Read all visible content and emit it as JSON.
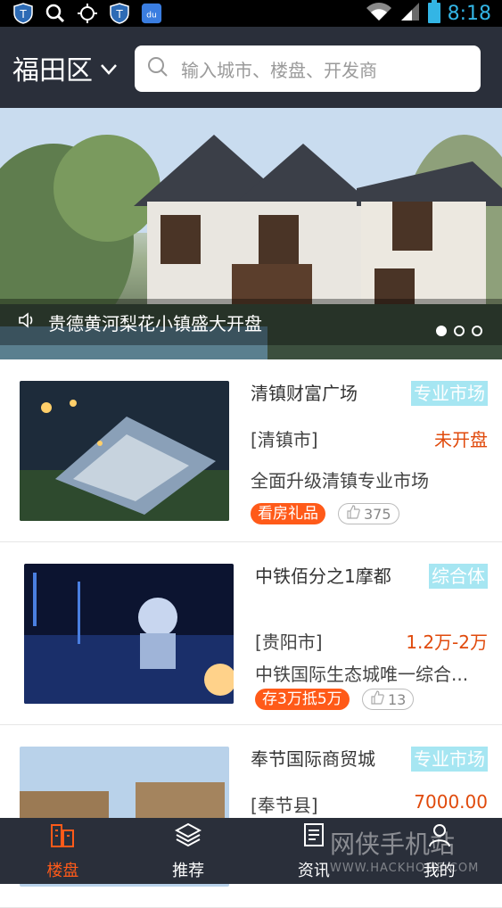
{
  "status_bar": {
    "time": "8:18",
    "icons": [
      "shield-app-icon",
      "search-icon",
      "locate-icon",
      "shield-app-icon",
      "baidu-app-icon",
      "wifi-icon",
      "signal-icon",
      "battery-icon"
    ],
    "baidu_label": "du"
  },
  "header": {
    "location": "福田区",
    "search_placeholder": "输入城市、楼盘、开发商"
  },
  "banner": {
    "title": "贵德黄河梨花小镇盛大开盘",
    "slides": 3,
    "active_slide": 0
  },
  "listings": [
    {
      "name": "清镇财富广场",
      "tag": "专业市场",
      "city": "[清镇市]",
      "price": "未开盘",
      "desc": "全面升级清镇专业市场",
      "badge": "看房礼品",
      "likes": "375"
    },
    {
      "name": "中铁佰分之1摩都",
      "tag": "综合体",
      "city": "[贵阳市]",
      "price": "1.2万-2万",
      "desc": "中铁国际生态城唯一综合...",
      "badge": "存3万抵5万",
      "likes": "13"
    },
    {
      "name": "奉节国际商贸城",
      "tag": "专业市场",
      "city": "[奉节县]",
      "price": "7000.00"
    }
  ],
  "tabs": [
    {
      "label": "楼盘",
      "icon": "building-icon",
      "active": true
    },
    {
      "label": "推荐",
      "icon": "layers-icon",
      "active": false
    },
    {
      "label": "资讯",
      "icon": "news-icon",
      "active": false
    },
    {
      "label": "我的",
      "icon": "user-icon",
      "active": false
    }
  ],
  "watermark": {
    "text": "网侠手机站",
    "sub": "WWW.HACKHOME.COM"
  },
  "colors": {
    "accent": "#ff5a19",
    "header_bg": "#2a2f3a",
    "tag_bg": "#a6e6f2",
    "price": "#e04a0c"
  }
}
